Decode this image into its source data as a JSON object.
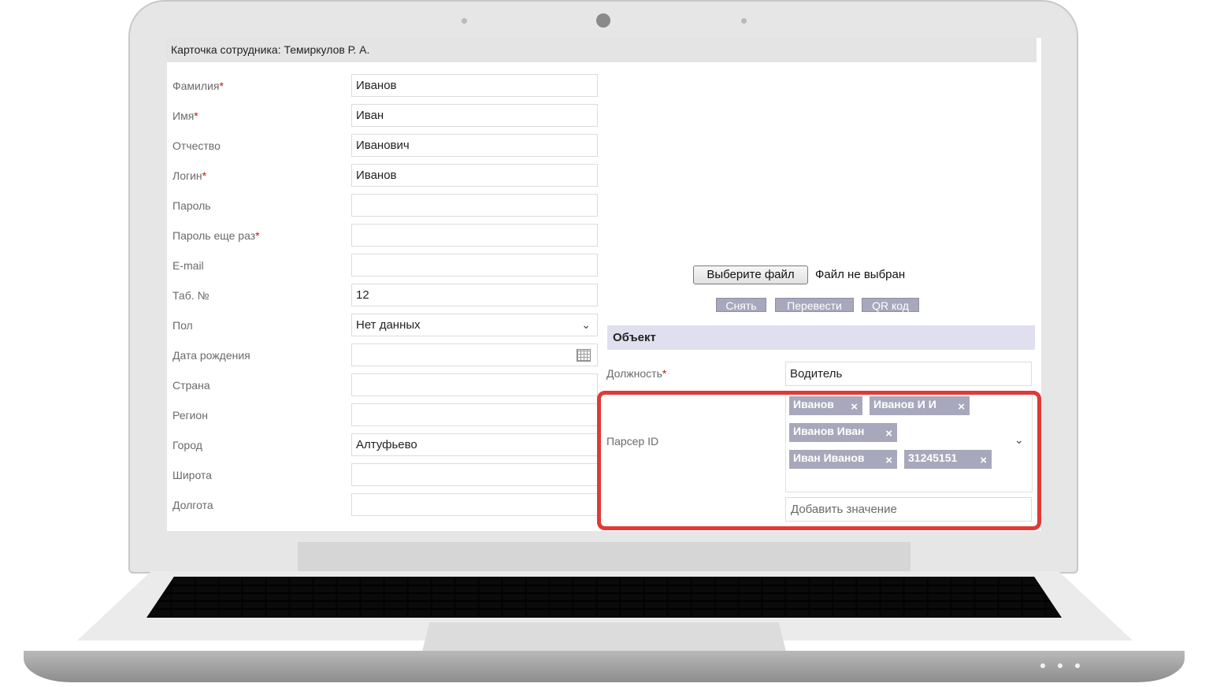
{
  "header": {
    "title": "Карточка сотрудника: Темиркулов Р. А."
  },
  "form_left": [
    {
      "label": "Фамилия",
      "required": "*",
      "value": "Иванов"
    },
    {
      "label": "Имя",
      "required": "*",
      "value": "Иван"
    },
    {
      "label": "Отчество",
      "required": "",
      "value": "Иванович"
    },
    {
      "label": "Логин",
      "required": "*",
      "value": "Иванов"
    },
    {
      "label": "Пароль",
      "required": "",
      "value": ""
    },
    {
      "label": "Пароль еще раз",
      "required": "*",
      "value": ""
    },
    {
      "label": "E-mail",
      "required": "",
      "value": ""
    },
    {
      "label": "Таб. №",
      "required": "",
      "value": "12"
    },
    {
      "label": "Пол",
      "required": "",
      "value": "Нет данных"
    },
    {
      "label": "Дата рождения",
      "required": "",
      "value": ""
    },
    {
      "label": "Страна",
      "required": "",
      "value": ""
    },
    {
      "label": "Регион",
      "required": "",
      "value": ""
    },
    {
      "label": "Город",
      "required": "",
      "value": "Алтуфьево"
    },
    {
      "label": "Широта",
      "required": "",
      "value": ""
    },
    {
      "label": "Долгота",
      "required": "",
      "value": ""
    }
  ],
  "photo": {
    "choose_file_label": "Выберите файл",
    "file_status": "Файл не выбран",
    "remove_label": "Снять",
    "transfer_label": "Перевести",
    "qr_label": "QR код"
  },
  "object_section": {
    "title": "Объект",
    "position_label": "Должность",
    "position_required": "*",
    "position_value": "Водитель",
    "parser_label": "Парсер ID",
    "parser_tags": [
      "Иванов",
      "Иванов И И",
      "Иванов Иван",
      "Иван Иванов",
      "31245151"
    ],
    "tag_remove_icon": "×",
    "add_value_placeholder": "Добавить значение"
  },
  "icons": {
    "dropdown": "chevron-down-icon",
    "calendar": "calendar-icon",
    "tag_remove": "close-icon"
  },
  "colors": {
    "highlight": "#e03a36",
    "tag_bg": "#a8a8bc",
    "section_bg": "#e0dfef",
    "required": "#d01010"
  }
}
